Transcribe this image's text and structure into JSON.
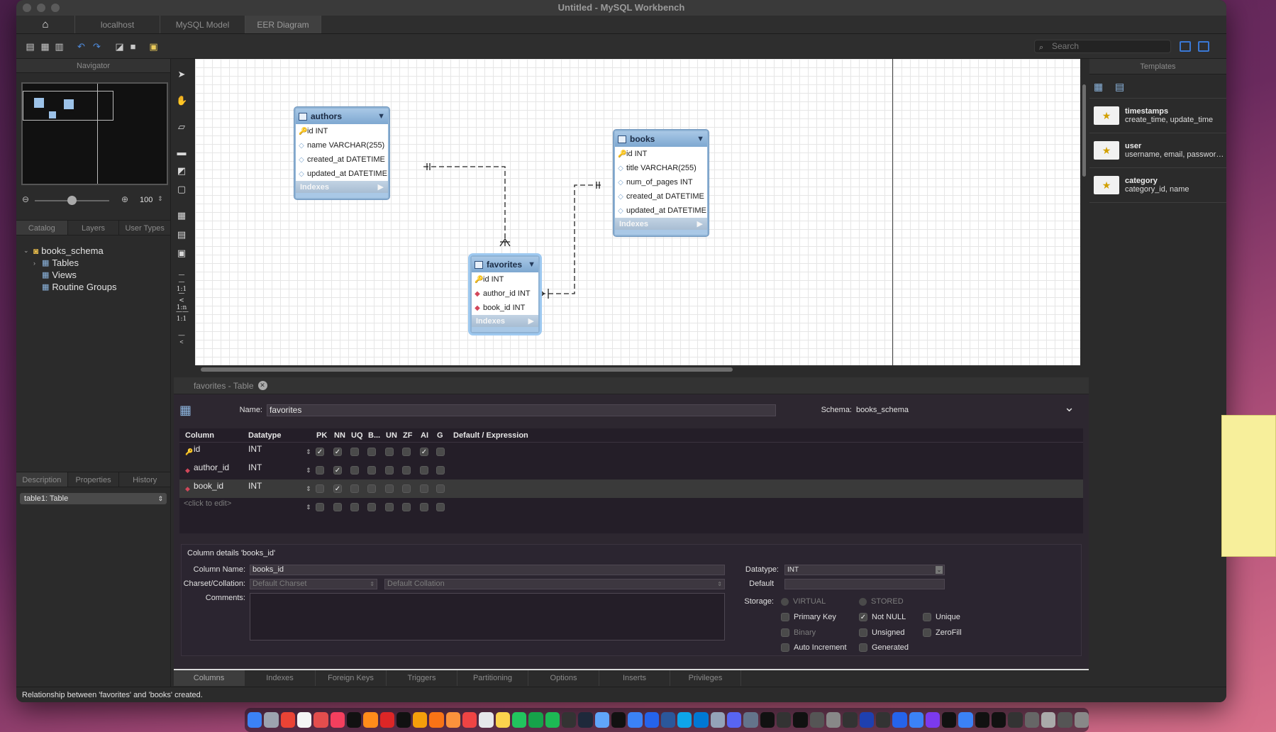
{
  "window": {
    "title": "Untitled - MySQL Workbench"
  },
  "tabs": [
    {
      "label": "localhost"
    },
    {
      "label": "MySQL Model"
    },
    {
      "label": "EER Diagram"
    }
  ],
  "search": {
    "placeholder": "Search"
  },
  "navigator": {
    "title": "Navigator",
    "zoom": "100"
  },
  "left_tabs": [
    "Catalog",
    "Layers",
    "User Types"
  ],
  "tree": {
    "schema": "books_schema",
    "items": [
      "Tables",
      "Views",
      "Routine Groups"
    ]
  },
  "bottom_left_tabs": [
    "Description",
    "Properties",
    "History"
  ],
  "description_select": "table1: Table",
  "tool_labels": {
    "rel_1_1_a": "1:1",
    "rel_1_n": "1:n",
    "rel_1_1_b": "1:1"
  },
  "diagram": {
    "authors": {
      "name": "authors",
      "columns": [
        {
          "key": "pk",
          "text": "id INT"
        },
        {
          "key": "col",
          "text": "name VARCHAR(255)"
        },
        {
          "key": "col",
          "text": "created_at DATETIME"
        },
        {
          "key": "col",
          "text": "updated_at DATETIME"
        }
      ],
      "indexes": "Indexes"
    },
    "books": {
      "name": "books",
      "columns": [
        {
          "key": "pk",
          "text": "id INT"
        },
        {
          "key": "col",
          "text": "title VARCHAR(255)"
        },
        {
          "key": "col",
          "text": "num_of_pages INT"
        },
        {
          "key": "col",
          "text": "created_at DATETIME"
        },
        {
          "key": "col",
          "text": "updated_at DATETIME"
        }
      ],
      "indexes": "Indexes"
    },
    "favorites": {
      "name": "favorites",
      "columns": [
        {
          "key": "pk",
          "text": "id INT"
        },
        {
          "key": "fk",
          "text": "author_id INT"
        },
        {
          "key": "fk",
          "text": "book_id INT"
        }
      ],
      "indexes": "Indexes"
    }
  },
  "templates": {
    "title": "Templates",
    "items": [
      {
        "name": "timestamps",
        "desc": "create_time, update_time"
      },
      {
        "name": "user",
        "desc": "username, email, password, c..."
      },
      {
        "name": "category",
        "desc": "category_id, name"
      }
    ]
  },
  "editor": {
    "tab_label": "favorites - Table",
    "name_label": "Name:",
    "name_value": "favorites",
    "schema_label": "Schema:",
    "schema_value": "books_schema",
    "headers": [
      "Column",
      "Datatype",
      "PK",
      "NN",
      "UQ",
      "B...",
      "UN",
      "ZF",
      "AI",
      "G",
      "Default / Expression"
    ],
    "rows": [
      {
        "icon": "pk",
        "name": "id",
        "type": "INT",
        "checks": [
          true,
          true,
          false,
          false,
          false,
          false,
          true,
          false
        ]
      },
      {
        "icon": "fk",
        "name": "author_id",
        "type": "INT",
        "checks": [
          false,
          true,
          false,
          false,
          false,
          false,
          false,
          false
        ]
      },
      {
        "icon": "fk",
        "name": "book_id",
        "type": "INT",
        "checks": [
          false,
          true,
          false,
          false,
          false,
          false,
          false,
          false
        ]
      },
      {
        "icon": "",
        "name": "<click to edit>",
        "type": "",
        "checks": [
          false,
          false,
          false,
          false,
          false,
          false,
          false,
          false
        ]
      }
    ],
    "details": {
      "title": "Column details 'books_id'",
      "column_name_label": "Column Name:",
      "column_name": "books_id",
      "charset_label": "Charset/Collation:",
      "charset": "Default Charset",
      "collation": "Default Collation",
      "comments_label": "Comments:",
      "datatype_label": "Datatype:",
      "datatype": "INT",
      "default_label": "Default",
      "storage_label": "Storage:",
      "storage_virtual": "VIRTUAL",
      "storage_stored": "STORED",
      "opts": {
        "primary_key": "Primary Key",
        "not_null": "Not NULL",
        "unique": "Unique",
        "binary": "Binary",
        "unsigned": "Unsigned",
        "zerofill": "ZeroFill",
        "auto_increment": "Auto Increment",
        "generated": "Generated"
      }
    },
    "bottom_tabs": [
      "Columns",
      "Indexes",
      "Foreign Keys",
      "Triggers",
      "Partitioning",
      "Options",
      "Inserts",
      "Privileges"
    ]
  },
  "status": "Relationship between 'favorites' and 'books' created.",
  "colors": {
    "accent": "#3a78d4",
    "table_header": "#7ea8d1",
    "note": "#f7ef9b"
  }
}
